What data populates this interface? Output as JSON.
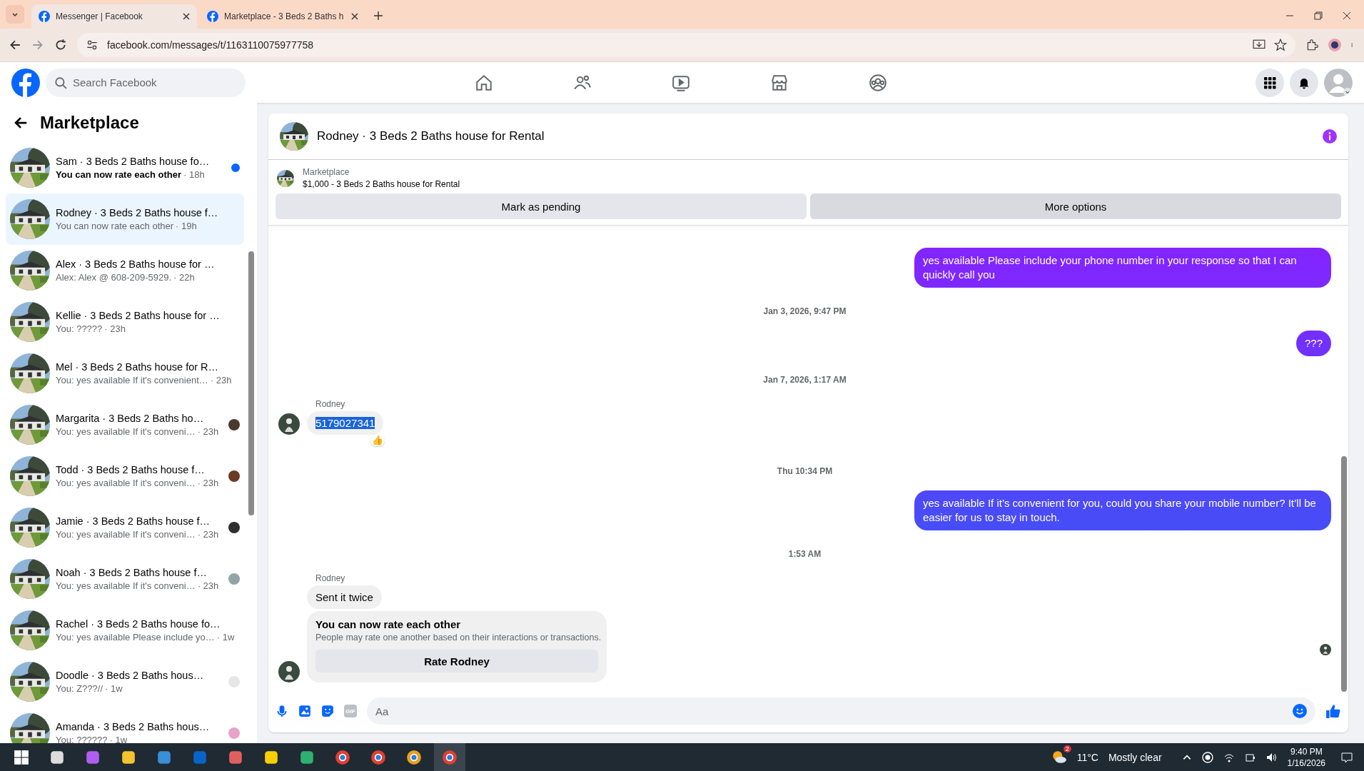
{
  "browser": {
    "tabs": [
      {
        "title": "Messenger | Facebook",
        "selected": true
      },
      {
        "title": "Marketplace - 3 Beds 2 Baths h",
        "selected": false
      }
    ],
    "url": "facebook.com/messages/t/1163110075977758"
  },
  "topbar": {
    "search": {
      "placeholder": "Search Facebook"
    },
    "nav": [
      {
        "kind": "home"
      },
      {
        "kind": "friends"
      },
      {
        "kind": "video"
      },
      {
        "kind": "marketplace"
      },
      {
        "kind": "groups"
      }
    ]
  },
  "sidebar": {
    "title": "Marketplace",
    "conversations": [
      {
        "title": "Sam · 3 Beds 2 Baths house fo…",
        "preview": "You can now rate each other",
        "time": "· 18h",
        "unread": true,
        "selected": false
      },
      {
        "title": "Rodney · 3 Beds 2 Baths house f…",
        "preview": "You can now rate each other",
        "time": "· 19h",
        "unread": false,
        "selected": true
      },
      {
        "title": "Alex · 3 Beds 2 Baths house for …",
        "preview": "Alex: Alex @ 608-209-5929.",
        "time": "· 22h",
        "unread": false,
        "selected": false
      },
      {
        "title": "Kellie · 3 Beds 2 Baths house for …",
        "preview": "You: ?????",
        "time": "· 23h",
        "unread": false,
        "selected": false
      },
      {
        "title": "Mel · 3 Beds 2 Baths house for R…",
        "preview": "You: yes available If it's convenient…",
        "time": "· 23h",
        "unread": false,
        "selected": false
      },
      {
        "title": "Margarita · 3 Beds 2 Baths ho…",
        "preview": "You: yes available If it's conveni…",
        "time": "· 23h",
        "unread": false,
        "selected": false,
        "color": "#4a3a30"
      },
      {
        "title": "Todd · 3 Beds 2 Baths house f…",
        "preview": "You: yes available If it's conveni…",
        "time": "· 23h",
        "unread": false,
        "selected": false,
        "color": "#6b3a22"
      },
      {
        "title": "Jamie · 3 Beds 2 Baths house f…",
        "preview": "You: yes available If it's conveni…",
        "time": "· 23h",
        "unread": false,
        "selected": false,
        "color": "#2e2e2e"
      },
      {
        "title": "Noah · 3 Beds 2 Baths house f…",
        "preview": "You: yes available If it's conveni…",
        "time": "· 23h",
        "unread": false,
        "selected": false,
        "color": "#8fa5a8"
      },
      {
        "title": "Rachel · 3 Beds 2 Baths house fo…",
        "preview": "You: yes available Please include yo…",
        "time": "· 1w",
        "unread": false,
        "selected": false
      },
      {
        "title": "Doodle · 3 Beds 2 Baths hous…",
        "preview": "You: Z???//",
        "time": "· 1w",
        "unread": false,
        "selected": false,
        "color": "#e6e6e6"
      },
      {
        "title": "Amanda · 3 Beds 2 Baths hous…",
        "preview": "You: ??????",
        "time": "· 1w",
        "unread": false,
        "selected": false,
        "color": "#e7a3c8"
      }
    ]
  },
  "chat": {
    "title": "Rodney · 3 Beds 2 Baths house for Rental",
    "listing": {
      "label": "Marketplace",
      "detail": "$1,000 - 3 Beds 2 Baths house for Rental"
    },
    "actions": [
      {
        "label": "Mark as pending",
        "hovered": false
      },
      {
        "label": "More options",
        "hovered": true
      }
    ],
    "messages": [
      {
        "kind": "outgoing",
        "text": "yes available Please include your phone number in your response so that I can quickly call you"
      },
      {
        "kind": "date",
        "text": "Jan 3, 2026, 9:47 PM"
      },
      {
        "kind": "outgoing",
        "text": "???"
      },
      {
        "kind": "date",
        "text": "Jan 7, 2026, 1:17 AM"
      },
      {
        "kind": "incoming",
        "sender": "Rodney",
        "text": "5179027341",
        "highlighted": true,
        "reaction": "👍",
        "avatar": true
      },
      {
        "kind": "date",
        "text": "Thu 10:34 PM"
      },
      {
        "kind": "outgoing",
        "text": "yes available If it’s convenient for you, could you share your mobile number? It’ll be easier for us to stay in touch."
      },
      {
        "kind": "date",
        "text": "1:53 AM"
      },
      {
        "kind": "incoming",
        "sender": "Rodney",
        "text": "Sent it twice",
        "highlighted": false,
        "avatar": false
      },
      {
        "kind": "rating",
        "title": "You can now rate each other",
        "body": "People may rate one another based on their interactions or transactions.",
        "button": "Rate Rodney",
        "avatar": true
      }
    ],
    "composer": {
      "gif": "GIF",
      "placeholder": "Aa"
    }
  },
  "taskbar": {
    "weather": {
      "badge": "2",
      "temp": "11°C",
      "condition": "Mostly clear"
    },
    "time": "9:40 PM",
    "date": "1/16/2026"
  }
}
